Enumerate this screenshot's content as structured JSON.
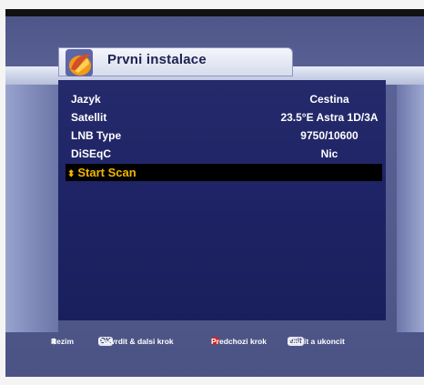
{
  "header": {
    "title": "Prvni instalace"
  },
  "settings": [
    {
      "label": "Jazyk",
      "value": "Cestina"
    },
    {
      "label": "Satellit",
      "value": "23.5°E Astra 1D/3A"
    },
    {
      "label": "LNB Type",
      "value": "9750/10600"
    },
    {
      "label": "DiSEqC",
      "value": "Nic"
    }
  ],
  "selected_item": {
    "label": "Start Scan"
  },
  "footer": {
    "mode_label": "Rezim",
    "ok_key": "OK",
    "ok_text": "Potvrdit & dalsi krok",
    "red_text": "Predchozi krok",
    "exit_key": "exit",
    "exit_text": "Zavrit a ukoncit"
  },
  "colors": {
    "highlight": "#f2b500",
    "panel": "#1d2264",
    "red_button": "#d62222"
  }
}
